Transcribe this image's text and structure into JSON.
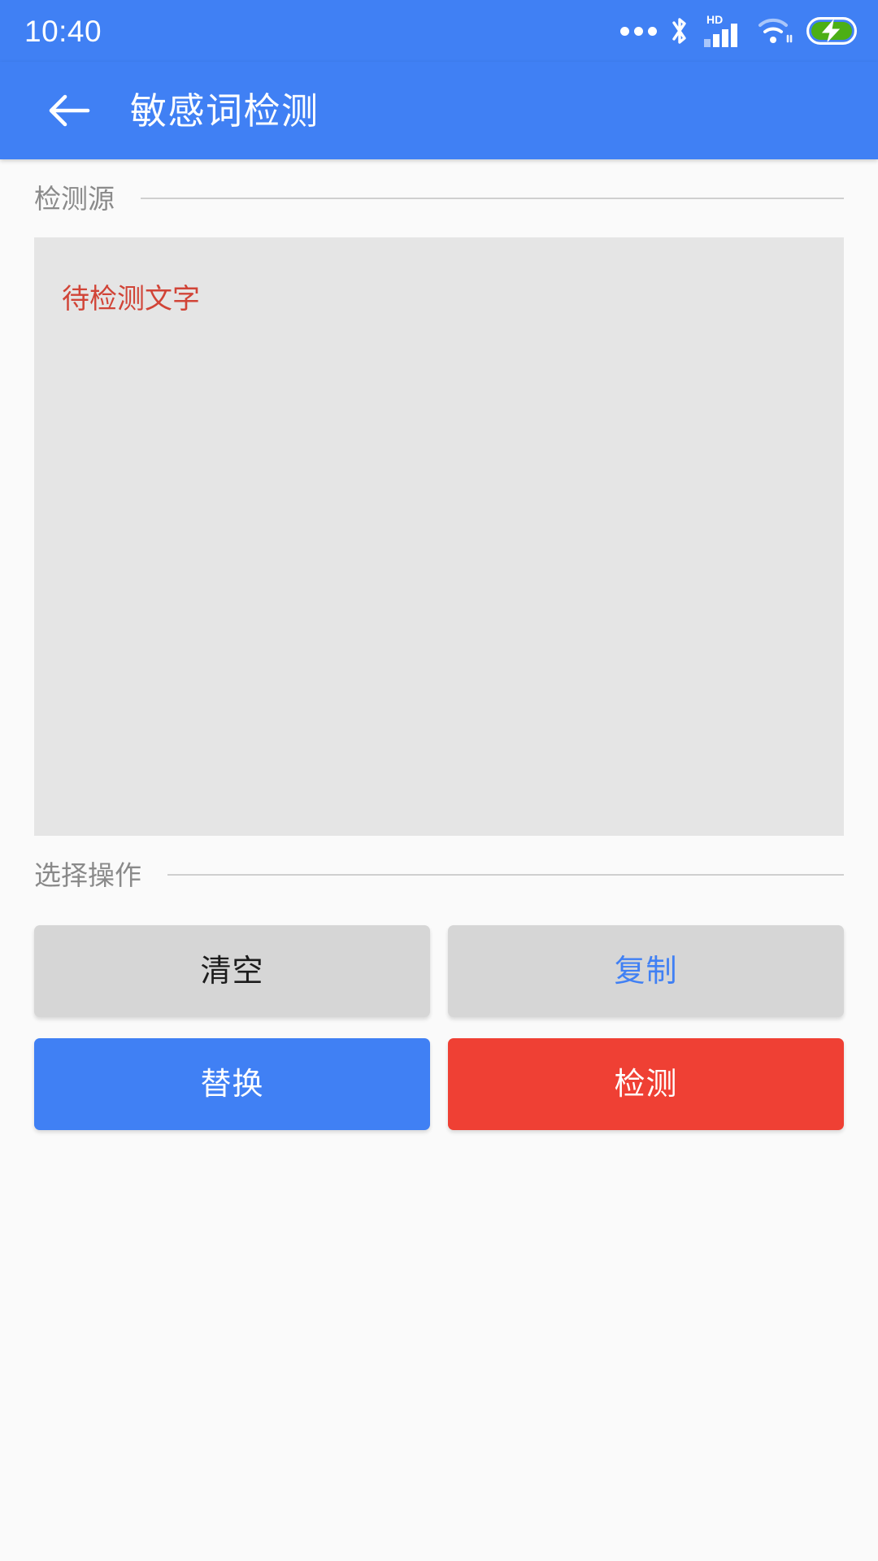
{
  "status_bar": {
    "time": "10:40",
    "icons": [
      {
        "name": "more-dots-icon",
        "label": "更多通知"
      },
      {
        "name": "bluetooth-icon",
        "label": "蓝牙"
      },
      {
        "name": "hd-label",
        "label": "HD"
      },
      {
        "name": "signal-bars-icon",
        "label": "信号"
      },
      {
        "name": "wifi-icon",
        "label": "WLAN"
      },
      {
        "name": "battery-charging-icon",
        "label": "充电中"
      }
    ],
    "background_color": "#4080f4",
    "foreground_color": "#ffffff",
    "battery_fill_color": "#4caf14"
  },
  "app_bar": {
    "back_label": "返回",
    "title": "敏感词检测",
    "background_color": "#4080f4",
    "title_color": "#ffffff"
  },
  "sections": {
    "source": {
      "header": "检测源",
      "placeholder": "待检测文字",
      "value": "",
      "text_color": "#d14437",
      "field_background": "#e5e5e5"
    },
    "operations": {
      "header": "选择操作",
      "buttons": [
        {
          "name": "clear-button",
          "label": "清空",
          "style": "gray",
          "text_color": "#1c1c1c",
          "background_color": "#d6d6d6"
        },
        {
          "name": "copy-button",
          "label": "复制",
          "style": "gray-blue",
          "text_color": "#4080f4",
          "background_color": "#d6d6d6"
        },
        {
          "name": "replace-button",
          "label": "替换",
          "style": "blue",
          "text_color": "#ffffff",
          "background_color": "#4080f4"
        },
        {
          "name": "detect-button",
          "label": "检测",
          "style": "red",
          "text_color": "#ffffff",
          "background_color": "#ef4034"
        }
      ]
    }
  },
  "page": {
    "background_color": "#fafafa",
    "divider_color": "#cfcfcf",
    "section_label_color": "#8a8a8a"
  }
}
